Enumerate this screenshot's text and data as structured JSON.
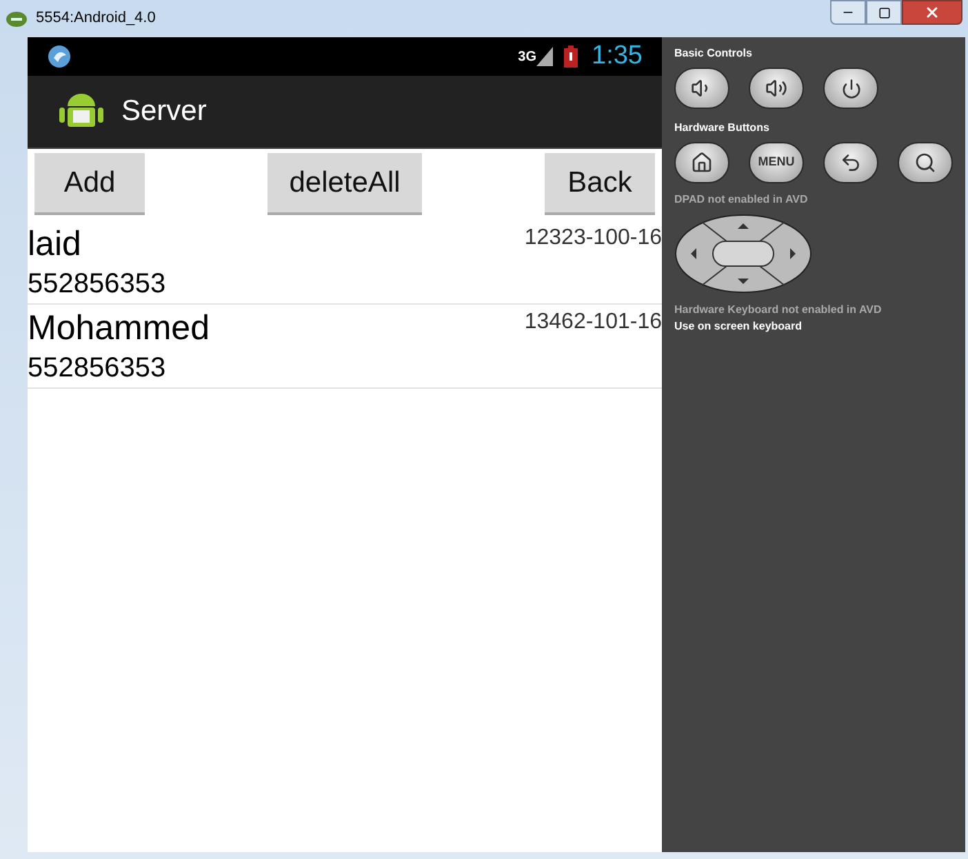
{
  "window": {
    "title": "5554:Android_4.0"
  },
  "status_bar": {
    "network": "3G",
    "time": "1:35"
  },
  "action_bar": {
    "title": "Server"
  },
  "buttons": [
    "Add",
    "deleteAll",
    "Back"
  ],
  "contacts": [
    {
      "name": "laid",
      "phone": "552856353",
      "code": "12323-100-16"
    },
    {
      "name": "Mohammed",
      "phone": "552856353",
      "code": "13462-101-16"
    }
  ],
  "controls": {
    "basic_title": "Basic Controls",
    "hardware_title": "Hardware Buttons",
    "menu_label": "MENU",
    "dpad_note": "**DPAD** not enabled in AVD",
    "keyboard_note": "**Hardware Keyboard** not enabled in AVD",
    "keyboard_hint": "Use on screen keyboard"
  }
}
